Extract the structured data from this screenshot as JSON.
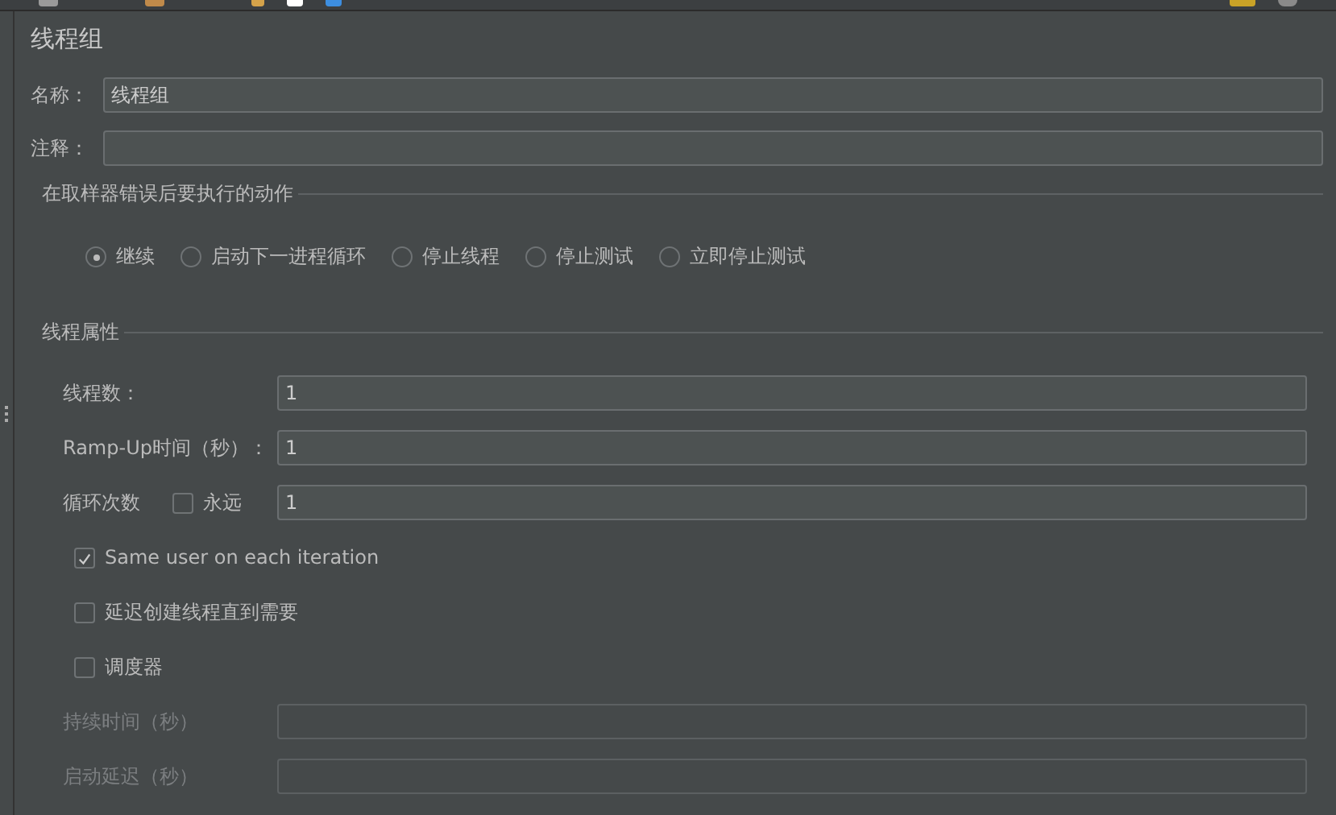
{
  "title": "线程组",
  "name_field": {
    "label": "名称：",
    "value": "线程组"
  },
  "comment_field": {
    "label": "注释："
  },
  "error_action": {
    "legend": "在取样器错误后要执行的动作",
    "options": [
      {
        "label": "继续",
        "selected": true
      },
      {
        "label": "启动下一进程循环",
        "selected": false
      },
      {
        "label": "停止线程",
        "selected": false
      },
      {
        "label": "停止测试",
        "selected": false
      },
      {
        "label": "立即停止测试",
        "selected": false
      }
    ]
  },
  "thread_properties": {
    "legend": "线程属性",
    "fields": [
      {
        "kind": "text",
        "label": "线程数：",
        "value": "1",
        "disabled": false
      },
      {
        "kind": "text",
        "label": "Ramp-Up时间（秒）：",
        "value": "1",
        "disabled": false
      },
      {
        "kind": "loop",
        "label": "循环次数",
        "checkbox_label": "永远",
        "checked": false,
        "value": "1",
        "disabled": false
      }
    ],
    "checkboxes": [
      {
        "label": "Same user on each iteration",
        "checked": true
      },
      {
        "label": "延迟创建线程直到需要",
        "checked": false
      },
      {
        "label": "调度器",
        "checked": false
      }
    ],
    "scheduler_fields": [
      {
        "kind": "text",
        "label": "持续时间（秒）",
        "disabled": true
      },
      {
        "kind": "text",
        "label": "启动延迟（秒）",
        "disabled": true
      }
    ]
  }
}
